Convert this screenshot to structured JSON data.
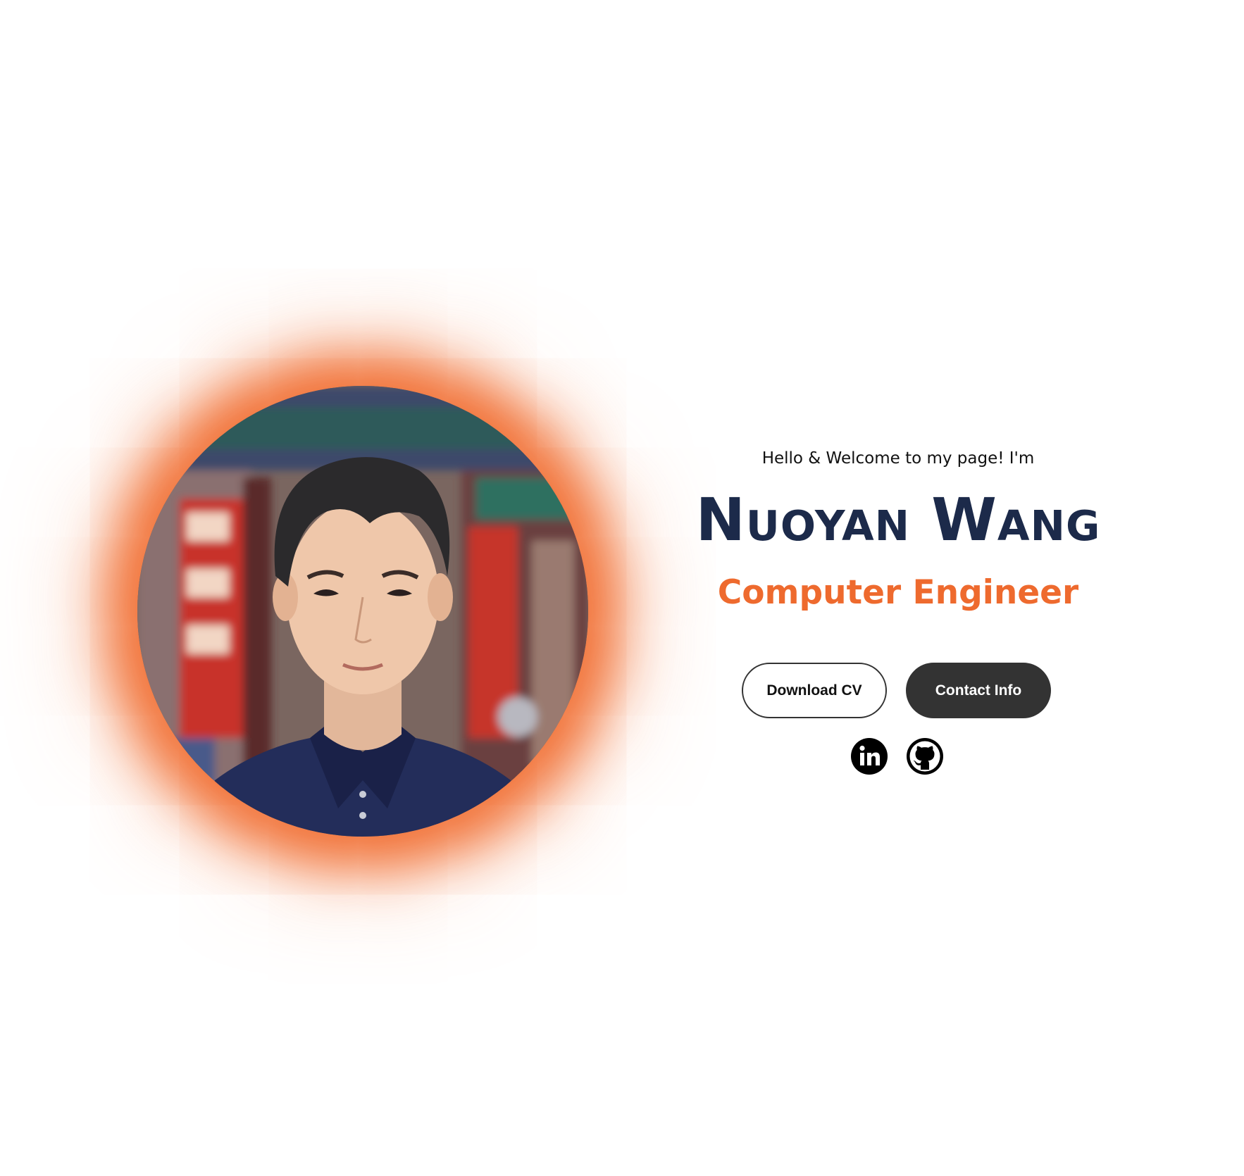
{
  "hero": {
    "greeting": "Hello & Welcome to my page! I'm",
    "name": "Nuoyan Wang",
    "role": "Computer Engineer",
    "photo_alt": "profile-photo"
  },
  "actions": {
    "download_cv": "Download CV",
    "contact_info": "Contact Info"
  },
  "socials": [
    {
      "icon": "linkedin-icon"
    },
    {
      "icon": "github-icon"
    }
  ],
  "colors": {
    "name": "#1c2a4a",
    "role": "#ee6a2e",
    "glow": "#f06e32",
    "primary_button": "#333333"
  }
}
